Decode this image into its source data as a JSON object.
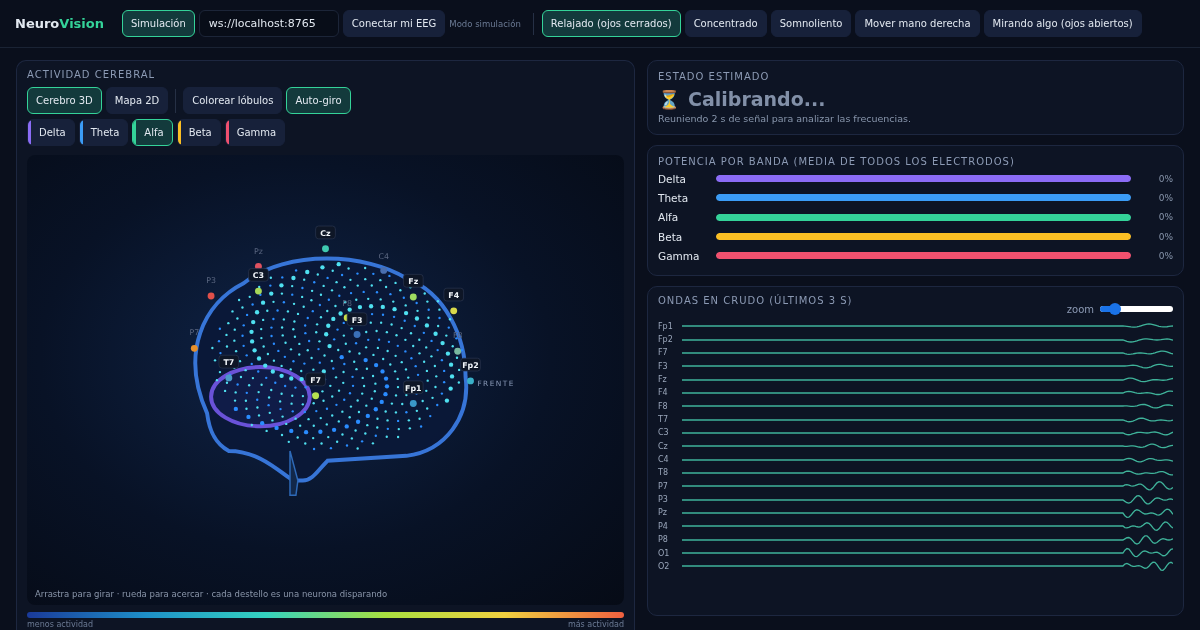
{
  "header": {
    "logo": {
      "part_1": "Neuro",
      "part_2": "Vision"
    },
    "mode_button": {
      "label": "Simulación",
      "selected": true
    },
    "url_field": {
      "value": "ws://localhost:8765"
    },
    "connect_button": "Conectar mi EEG",
    "mode_status": "Modo simulación",
    "states": [
      {
        "label": "Relajado (ojos cerrados)",
        "selected": true
      },
      {
        "label": "Concentrado",
        "selected": false
      },
      {
        "label": "Somnoliento",
        "selected": false
      },
      {
        "label": "Mover mano derecha",
        "selected": false
      },
      {
        "label": "Mirando algo (ojos abiertos)",
        "selected": false
      }
    ]
  },
  "brain_panel": {
    "title": "ACTIVIDAD CEREBRAL",
    "view_buttons": [
      {
        "label": "Cerebro 3D",
        "selected": true
      },
      {
        "label": "Mapa 2D",
        "selected": false
      }
    ],
    "toggles": [
      {
        "label": "Colorear lóbulos",
        "on": false
      },
      {
        "label": "Auto-giro",
        "on": true
      }
    ],
    "bands": [
      {
        "label": "Delta",
        "color": "#8b6cf6",
        "selected": false
      },
      {
        "label": "Theta",
        "color": "#3b9cf6",
        "selected": false
      },
      {
        "label": "Alfa",
        "color": "#34d399",
        "selected": true
      },
      {
        "label": "Beta",
        "color": "#fbbf24",
        "selected": false
      },
      {
        "label": "Gamma",
        "color": "#f0506e",
        "selected": false
      }
    ],
    "electrodes": [
      {
        "label": "Cz",
        "color": "#3fc9b0",
        "behind": false
      },
      {
        "label": "Pz",
        "color": "#e05260",
        "behind": true
      },
      {
        "label": "C4",
        "color": "#4a6fb0",
        "behind": true
      },
      {
        "label": "P3",
        "color": "#e0504a",
        "behind": true
      },
      {
        "label": "C3",
        "color": "#a8d858",
        "behind": false
      },
      {
        "label": "Fz",
        "color": "#9edc60",
        "behind": false
      },
      {
        "label": "F4",
        "color": "#d8d84a",
        "behind": false
      },
      {
        "label": "P8",
        "color": "#c8e048",
        "behind": true
      },
      {
        "label": "F3",
        "color": "#3a70b8",
        "behind": false
      },
      {
        "label": "P7",
        "color": "#e8902a",
        "behind": true
      },
      {
        "label": "F8",
        "color": "#7ab8a0",
        "behind": true
      },
      {
        "label": "T7",
        "color": "#4a9ac8",
        "behind": false
      },
      {
        "label": "Fp2",
        "color": "#3ab0c8",
        "behind": false
      },
      {
        "label": "F7",
        "color": "#b8e050",
        "behind": false
      },
      {
        "label": "Fp1",
        "color": "#3a98c8",
        "behind": false
      }
    ],
    "orientation_label": "FRENTE",
    "hint": "Arrastra para girar · rueda para acercar · cada destello es una neurona disparando",
    "legend": {
      "low": "menos actividad",
      "high": "más actividad"
    }
  },
  "state_panel": {
    "title": "ESTADO ESTIMADO",
    "icon": "⏳",
    "status": "Calibrando...",
    "detail": "Reuniendo 2 s de señal para analizar las frecuencias."
  },
  "power_panel": {
    "title": "POTENCIA POR BANDA (MEDIA DE TODOS LOS ELECTRODOS)",
    "bands": [
      {
        "label": "Delta",
        "color": "#8b6cf6",
        "level": 1,
        "reading": "0%"
      },
      {
        "label": "Theta",
        "color": "#3b9cf6",
        "level": 1,
        "reading": "0%"
      },
      {
        "label": "Alfa",
        "color": "#34d399",
        "level": 1,
        "reading": "0%"
      },
      {
        "label": "Beta",
        "color": "#fbbf24",
        "level": 1,
        "reading": "0%"
      },
      {
        "label": "Gamma",
        "color": "#f0506e",
        "level": 1,
        "reading": "0%"
      }
    ]
  },
  "waves_panel": {
    "title": "ONDAS EN CRUDO (ÚLTIMOS 3 S)",
    "zoom": {
      "label": "zoom",
      "level": 0.2
    },
    "channels": [
      "Fp1",
      "Fp2",
      "F7",
      "F3",
      "Fz",
      "F4",
      "F8",
      "T7",
      "C3",
      "Cz",
      "C4",
      "T8",
      "P7",
      "P3",
      "Pz",
      "P4",
      "P8",
      "O1",
      "O2"
    ]
  }
}
